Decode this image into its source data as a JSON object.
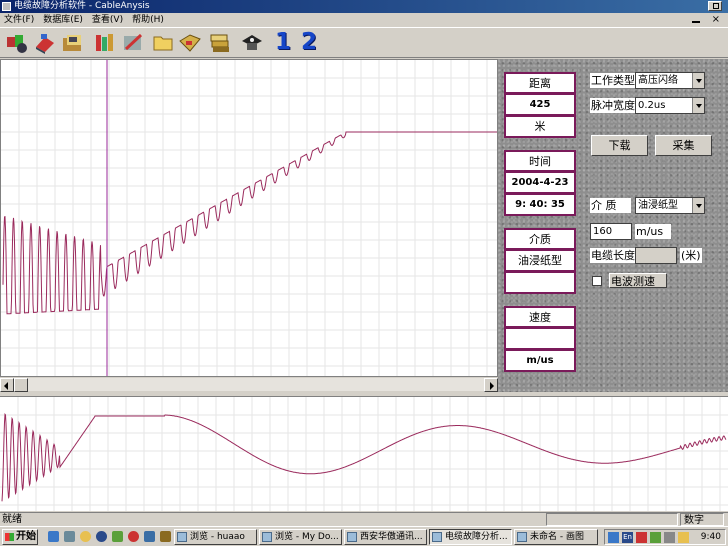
{
  "window": {
    "title": "电缆故障分析软件 - CableAnysis"
  },
  "menu": [
    "文件(F)",
    "数据库(E)",
    "查看(V)",
    "帮助(H)"
  ],
  "toolbar": {
    "icons": [
      "tools-icon",
      "book-icon",
      "folder-open-icon",
      "users-icon",
      "edit-icon",
      "folder-icon",
      "open-file-icon",
      "stack-icon",
      "hat-icon"
    ],
    "channel_1": "1",
    "channel_2": "2"
  },
  "readouts": {
    "distance": {
      "label": "距离",
      "value": "425",
      "unit": "米"
    },
    "time": {
      "label": "时间",
      "date": "2004-4-23",
      "clock": "9: 40: 35"
    },
    "medium": {
      "label": "介质",
      "value": "油浸纸型",
      "extra": ""
    },
    "speed": {
      "label": "速度",
      "value": "",
      "unit": "m/us"
    }
  },
  "controls": {
    "work_type_label": "工作类型",
    "work_type_value": "高压闪络",
    "pulse_width_label": "脉冲宽度",
    "pulse_width_value": "0.2us",
    "download_label": "下载",
    "collect_label": "采集",
    "medium_label": "介  质",
    "medium_value": "油浸纸型",
    "speed_value": "160",
    "speed_unit": "m/us",
    "cable_length_label": "电缆长度",
    "cable_length_value": "",
    "cable_length_unit": "(米)",
    "wave_measure_label": "电波测速",
    "wave_measure_checked": false
  },
  "statusbar": {
    "left": "就绪",
    "mode": "数字"
  },
  "taskbar": {
    "start_label": "开始",
    "tasks": [
      "浏览 - huaao",
      "浏览 - My Do...",
      "西安华傲通讯...",
      "电缆故障分析...",
      "未命名 - 画图"
    ],
    "active_index": 3,
    "clock": "9:40"
  },
  "colors": {
    "trace": "#9a2a5c",
    "grid": "#e6e6e6",
    "cursor": "#9a2a9a",
    "panel_border": "#7a1a5a"
  }
}
